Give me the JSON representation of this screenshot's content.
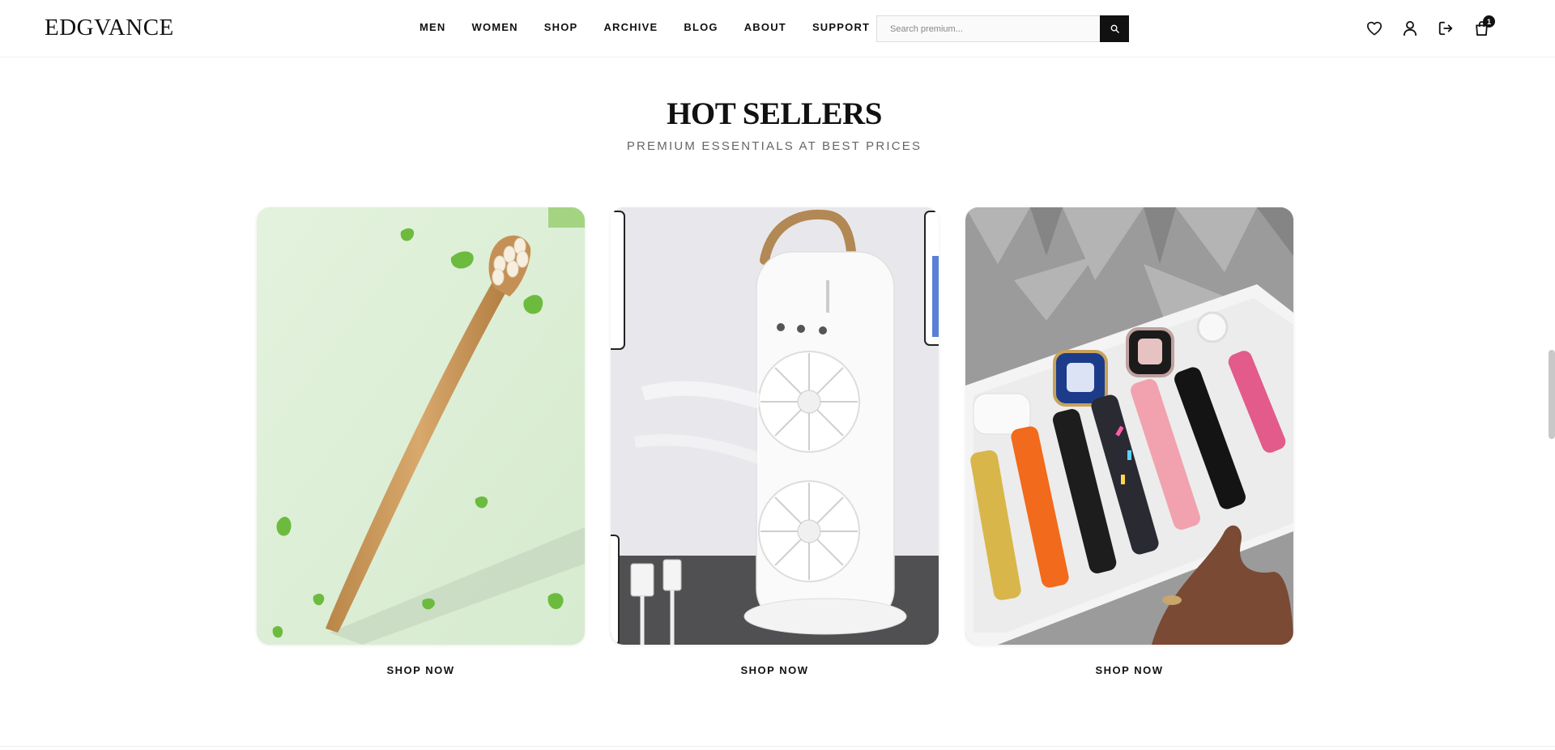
{
  "header": {
    "logo": "EDGVANCE",
    "nav": [
      {
        "label": "MEN"
      },
      {
        "label": "WOMEN"
      },
      {
        "label": "SHOP"
      },
      {
        "label": "ARCHIVE"
      },
      {
        "label": "BLOG"
      },
      {
        "label": "ABOUT"
      },
      {
        "label": "SUPPORT"
      }
    ],
    "search": {
      "placeholder": "Search premium...",
      "value": ""
    },
    "icons": [
      "heart-icon",
      "user-icon",
      "logout-icon",
      "shopping-bag-icon"
    ],
    "cart_count": "1"
  },
  "section": {
    "title": "HOT SELLERS",
    "subtitle": "PREMIUM ESSENTIALS AT BEST PRICES"
  },
  "products": [
    {
      "cta": "SHOP NOW"
    },
    {
      "cta": "SHOP NOW"
    },
    {
      "cta": "SHOP NOW"
    }
  ],
  "colors": {
    "primary": "#111111",
    "muted": "#666666",
    "card_green_bg": "#dcefd6",
    "bamboo": "#c8955a",
    "fan_bg": "#e9e9ec",
    "watch_tray": "#f3f3f3",
    "watch_orange": "#f26a1b"
  }
}
